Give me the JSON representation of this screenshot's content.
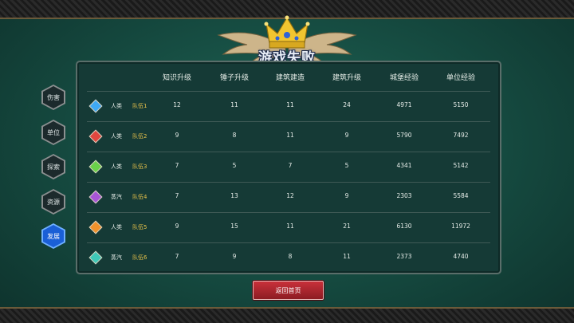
{
  "title": "游戏失败",
  "sidebar": {
    "items": [
      {
        "label": "伤害",
        "active": false
      },
      {
        "label": "单位",
        "active": false
      },
      {
        "label": "探索",
        "active": false
      },
      {
        "label": "资源",
        "active": false
      },
      {
        "label": "发展",
        "active": true
      }
    ]
  },
  "table": {
    "headers": [
      "知识升级",
      "锤子升级",
      "建筑建造",
      "建筑升级",
      "城堡经验",
      "单位经验"
    ],
    "rows": [
      {
        "gem": "#3fa9f5",
        "race": "人类",
        "team": "队伍1",
        "values": [
          "12",
          "11",
          "11",
          "24",
          "4971",
          "5150"
        ]
      },
      {
        "gem": "#e0463f",
        "race": "人类",
        "team": "队伍2",
        "values": [
          "9",
          "8",
          "11",
          "9",
          "5790",
          "7492"
        ]
      },
      {
        "gem": "#6ad24a",
        "race": "人类",
        "team": "队伍3",
        "values": [
          "7",
          "5",
          "7",
          "5",
          "4341",
          "5142"
        ]
      },
      {
        "gem": "#a855d6",
        "race": "蒸汽",
        "team": "队伍4",
        "values": [
          "7",
          "13",
          "12",
          "9",
          "2303",
          "5584"
        ]
      },
      {
        "gem": "#f0922c",
        "race": "人类",
        "team": "队伍5",
        "values": [
          "9",
          "15",
          "11",
          "21",
          "6130",
          "11972"
        ]
      },
      {
        "gem": "#3fc9b8",
        "race": "蒸汽",
        "team": "队伍6",
        "values": [
          "7",
          "9",
          "8",
          "11",
          "2373",
          "4740"
        ]
      }
    ]
  },
  "return_button": "返回首页",
  "colors": {
    "team_text": "#e8c24a",
    "active_tab": "#1a5fd6"
  }
}
